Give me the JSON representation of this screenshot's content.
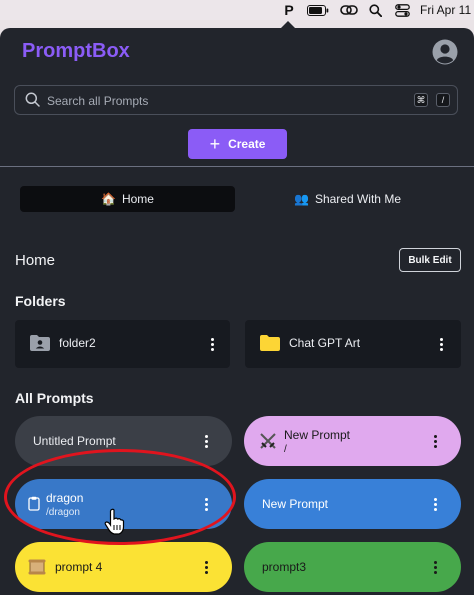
{
  "menubar": {
    "app_letter": "P",
    "clock": "Fri Apr 11",
    "icons": [
      "battery-icon",
      "link-icon",
      "search-icon",
      "control-center-icon"
    ]
  },
  "app": {
    "brand": "PromptBox",
    "brand_color": "#8b5cf6",
    "avatar_icon": "user-circle-icon"
  },
  "search": {
    "placeholder": "Search all Prompts",
    "value": "",
    "shortcut_mod": "⌘",
    "shortcut_key": "/"
  },
  "create": {
    "label": "Create",
    "icon": "plus-icon"
  },
  "tabs": [
    {
      "label": "Home",
      "emoji": "🏠",
      "active": true
    },
    {
      "label": "Shared With Me",
      "emoji": "👥",
      "active": false
    }
  ],
  "home": {
    "title": "Home",
    "bulk_edit_label": "Bulk Edit"
  },
  "folders": {
    "title": "Folders",
    "items": [
      {
        "label": "folder2",
        "icon": "shared-folder-icon",
        "color": "#9aa0aa"
      },
      {
        "label": "Chat GPT Art",
        "icon": "folder-icon",
        "color": "#fcd535"
      }
    ]
  },
  "prompts": {
    "title": "All Prompts",
    "items": [
      {
        "title": "Untitled Prompt",
        "subtitle": "",
        "icon": "",
        "bg": "#3b3f47",
        "fg": "#eceef2"
      },
      {
        "title": "New Prompt",
        "subtitle": "/",
        "icon": "crossed-swords-icon",
        "bg": "#e0a9ee",
        "fg": "#1a1a1a"
      },
      {
        "title": "dragon",
        "subtitle": "/dragon",
        "icon": "clipboard-icon",
        "bg": "#3878c8",
        "fg": "#ffffff"
      },
      {
        "title": "New Prompt",
        "subtitle": "",
        "icon": "",
        "bg": "#3880d8",
        "fg": "#ffffff"
      },
      {
        "title": "prompt 4",
        "subtitle": "",
        "icon": "scroll-icon",
        "bg": "#fbe234",
        "fg": "#1a1a1a"
      },
      {
        "title": "prompt3",
        "subtitle": "",
        "icon": "",
        "bg": "#47a84b",
        "fg": "#1a1a1a"
      }
    ]
  },
  "annotation_color": "#e0141e"
}
